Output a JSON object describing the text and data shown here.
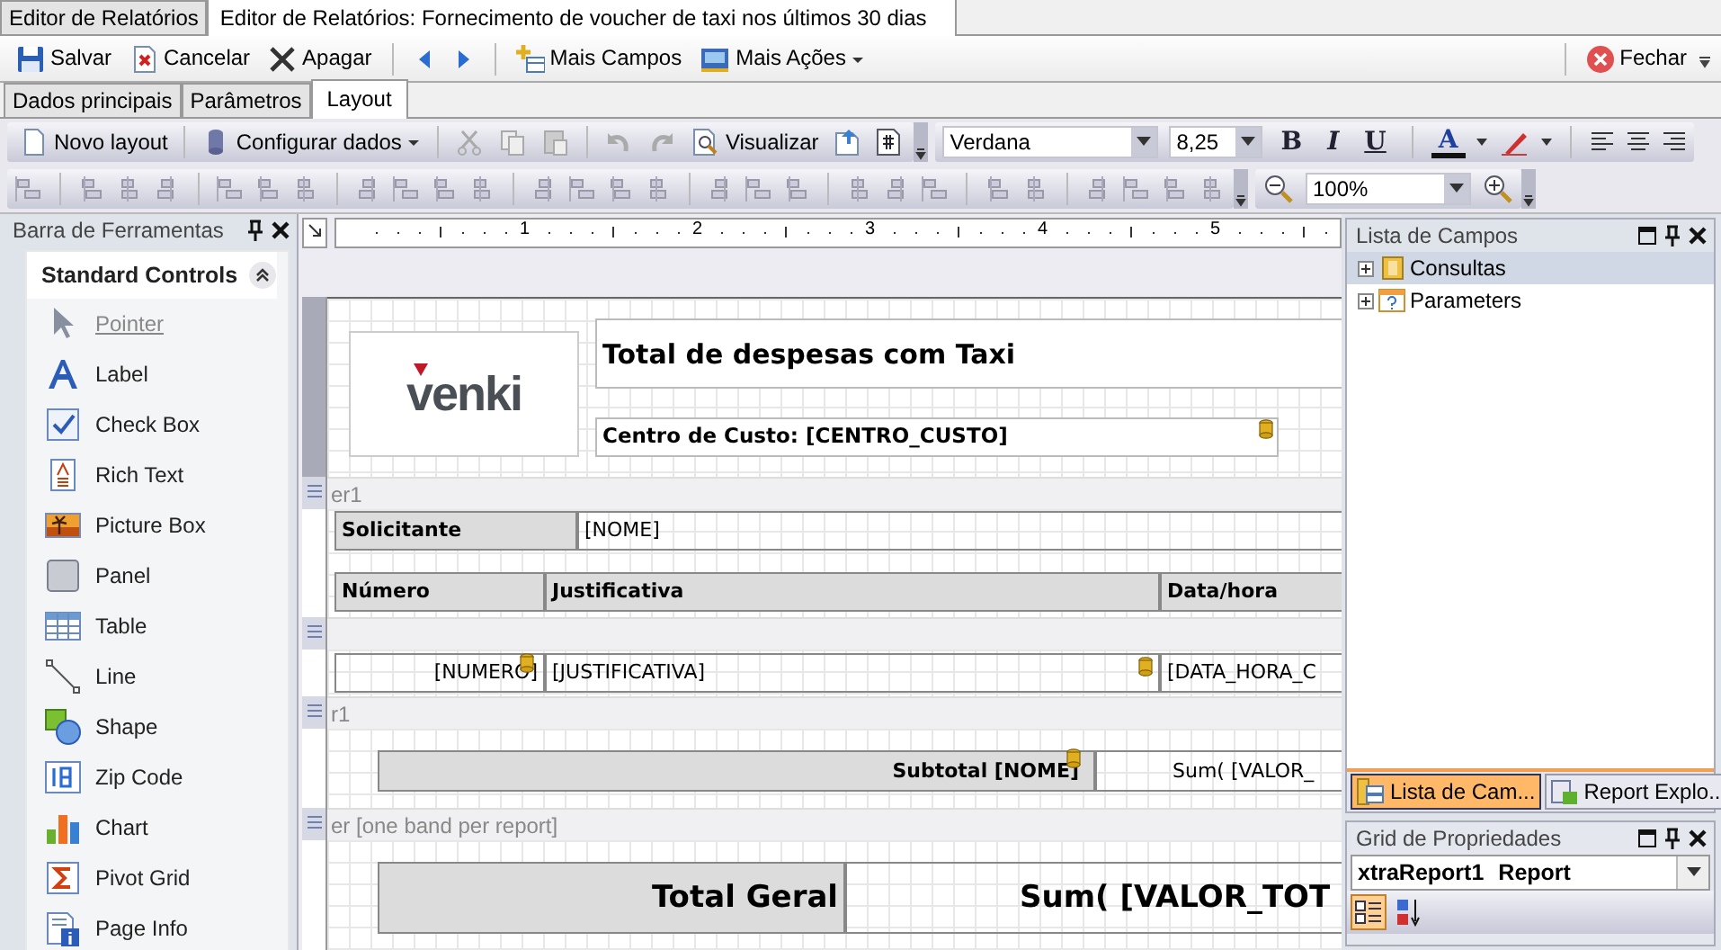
{
  "document_tabs": [
    {
      "label": "Editor de Relatórios",
      "selected": false
    },
    {
      "label": "Editor de Relatórios: Fornecimento de voucher de taxi nos últimos 30 dias",
      "selected": true
    }
  ],
  "main_toolbar": {
    "save": "Salvar",
    "cancel": "Cancelar",
    "delete": "Apagar",
    "more_fields": "Mais Campos",
    "more_actions": "Mais Ações",
    "close": "Fechar"
  },
  "sub_tabs": [
    {
      "label": "Dados principais",
      "selected": false
    },
    {
      "label": "Parâmetros",
      "selected": false
    },
    {
      "label": "Layout",
      "selected": true
    }
  ],
  "layout_toolbar": {
    "new_layout": "Novo layout",
    "configure_data": "Configurar dados",
    "preview": "Visualizar",
    "font": "Verdana",
    "font_size": "8,25",
    "bold": "B",
    "italic": "I",
    "underline": "U",
    "font_color": "A",
    "zoom": "100%"
  },
  "toolbox": {
    "title": "Barra de Ferramentas",
    "group": "Standard Controls",
    "items": [
      {
        "label": "Pointer",
        "selected": true
      },
      {
        "label": "Label",
        "selected": false
      },
      {
        "label": "Check Box",
        "selected": false
      },
      {
        "label": "Rich Text",
        "selected": false
      },
      {
        "label": "Picture Box",
        "selected": false
      },
      {
        "label": "Panel",
        "selected": false
      },
      {
        "label": "Table",
        "selected": false
      },
      {
        "label": "Line",
        "selected": false
      },
      {
        "label": "Shape",
        "selected": false
      },
      {
        "label": "Zip Code",
        "selected": false
      },
      {
        "label": "Chart",
        "selected": false
      },
      {
        "label": "Pivot Grid",
        "selected": false
      },
      {
        "label": "Page Info",
        "selected": false
      }
    ]
  },
  "report": {
    "ruler_numbers": [
      "1",
      "2",
      "3",
      "4",
      "5"
    ],
    "header": {
      "logo": "venki",
      "title": "Total de despesas com Taxi",
      "cost_center": "Centro de Custo: [CENTRO_CUSTO]"
    },
    "group_header": {
      "band_label": "er1",
      "requester_label": "Solicitante",
      "requester_value": "[NOME]",
      "columns": [
        "Número",
        "Justificativa",
        "Data/hora"
      ]
    },
    "detail": {
      "cells": [
        "[NUMERO]",
        "[JUSTIFICATIVA]",
        "[DATA_HORA_C"
      ]
    },
    "group_footer": {
      "band_label": "r1",
      "subtotal_label": "Subtotal [NOME]",
      "subtotal_value": "Sum( [VALOR_"
    },
    "report_footer": {
      "band_label": "er [one band per report]",
      "total_label": "Total Geral",
      "total_value": "Sum( [VALOR_TOT"
    }
  },
  "field_list": {
    "title": "Lista de Campos",
    "tree": [
      {
        "label": "Consultas",
        "selected": true
      },
      {
        "label": "Parameters",
        "selected": false
      }
    ],
    "tabs": [
      {
        "label": "Lista de Cam...",
        "selected": true
      },
      {
        "label": "Report Explo...",
        "selected": false
      }
    ]
  },
  "properties": {
    "title": "Grid de Propriedades",
    "object": "xtraReport1",
    "object_type": "Report",
    "sort_modes": [
      {
        "kind": "categorized",
        "selected": true
      },
      {
        "kind": "alphabetical",
        "selected": false
      }
    ]
  }
}
